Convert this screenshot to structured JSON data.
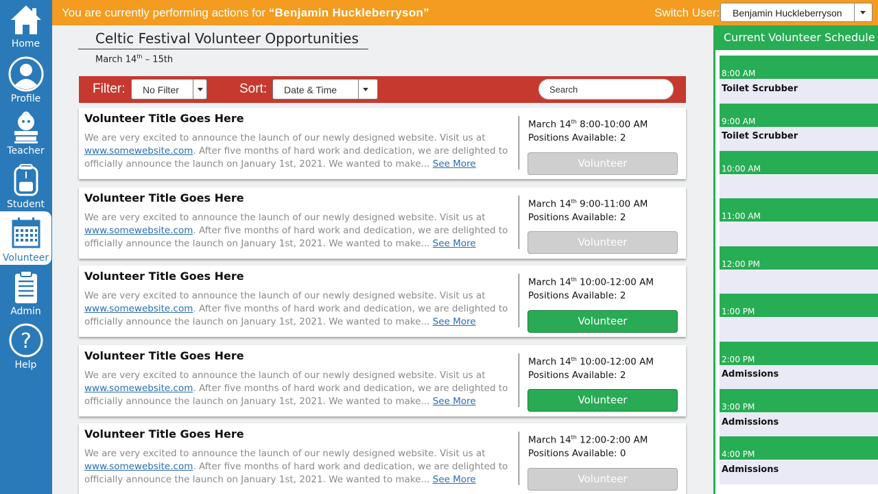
{
  "nav": [
    {
      "label": "Home",
      "icon": "home-icon"
    },
    {
      "label": "Profile",
      "icon": "profile-icon"
    },
    {
      "label": "Teacher",
      "icon": "teacher-icon"
    },
    {
      "label": "Student",
      "icon": "student-icon"
    },
    {
      "label": "Volunteer",
      "icon": "calendar-icon",
      "active": true
    },
    {
      "label": "Admin",
      "icon": "clipboard-icon"
    },
    {
      "label": "Help",
      "icon": "help-icon"
    }
  ],
  "banner": {
    "prefix": "You are currently  performing actions for ",
    "user": "“Benjamin  Huckleberryson”",
    "switch_label": "Switch User:",
    "selected_user": "Benjamin Huckleberryson"
  },
  "page": {
    "title": "Celtic Festival Volunteer Opportunities",
    "dates_prefix": "March 14",
    "dates_sup": "th",
    "dates_suffix": " – 15th"
  },
  "filterbar": {
    "filter_label": "Filter:",
    "filter_value": "No Filter",
    "sort_label": "Sort:",
    "sort_value": "Date & Time",
    "search_placeholder": "Search"
  },
  "cards": [
    {
      "title": "Volunteer Title Goes Here",
      "desc_1": "We are very excited to announce the launch of our newly designed website. Visit us at ",
      "link": "www.somewebsite.com",
      "desc_2": ".  After five months of hard work and dedication, we are delighted to officially announce the launch on January 1st, 2021. We wanted to make... ",
      "see_more": "See More",
      "date": "March 14",
      "date_sup": "th",
      "time": " 8:00-10:00 AM",
      "positions": "Positions Available: 2",
      "button": "Volunteer",
      "enabled": false
    },
    {
      "title": "Volunteer Title Goes Here",
      "desc_1": "We are very excited to announce the launch of our newly designed website. Visit us at ",
      "link": "www.somewebsite.com",
      "desc_2": ".  After five months of hard work and dedication, we are delighted to officially announce the launch on January 1st, 2021. We wanted to make... ",
      "see_more": "See More",
      "date": "March 14",
      "date_sup": "th",
      "time": " 9:00-11:00 AM",
      "positions": "Positions Available: 2",
      "button": "Volunteer",
      "enabled": false
    },
    {
      "title": "Volunteer Title Goes Here",
      "desc_1": "We are very excited to announce the launch of our newly designed website. Visit us at ",
      "link": "www.somewebsite.com",
      "desc_2": ".  After five months of hard work and dedication, we are delighted to officially announce the launch on January 1st, 2021. We wanted to make... ",
      "see_more": "See More",
      "date": "March 14",
      "date_sup": "th",
      "time": " 10:00-12:00 AM",
      "positions": "Positions Available: 2",
      "button": "Volunteer",
      "enabled": true
    },
    {
      "title": "Volunteer Title Goes Here",
      "desc_1": "We are very excited to announce the launch of our newly designed website. Visit us at ",
      "link": "www.somewebsite.com",
      "desc_2": ".  After five months of hard work and dedication, we are delighted to officially announce the launch on January 1st, 2021. We wanted to make... ",
      "see_more": "See More",
      "date": "March 14",
      "date_sup": "th",
      "time": " 10:00-12:00 AM",
      "positions": "Positions Available: 2",
      "button": "Volunteer",
      "enabled": true
    },
    {
      "title": "Volunteer Title Goes Here",
      "desc_1": "We are very excited to announce the launch of our newly designed website. Visit us at ",
      "link": "www.somewebsite.com",
      "desc_2": ".  After five months of hard work and dedication, we are delighted to officially announce the launch on January 1st, 2021. We wanted to make... ",
      "see_more": "See More",
      "date": "March 14",
      "date_sup": "th",
      "time": " 12:00-2:00 AM",
      "positions": "Positions Available: 0",
      "button": "Volunteer",
      "enabled": false
    }
  ],
  "schedule": {
    "title": "Current Volunteer Schedule",
    "slots": [
      {
        "time": "8:00 AM",
        "task": "Toilet Scrubber"
      },
      {
        "time": "9:00 AM",
        "task": "Toilet Scrubber"
      },
      {
        "time": "10:00 AM",
        "task": ""
      },
      {
        "time": "11:00 AM",
        "task": ""
      },
      {
        "time": "12:00 PM",
        "task": ""
      },
      {
        "time": "1:00 PM",
        "task": ""
      },
      {
        "time": "2:00 PM",
        "task": "Admissions"
      },
      {
        "time": "3:00 PM",
        "task": "Admissions"
      },
      {
        "time": "4:00 PM",
        "task": "Admissions"
      }
    ]
  },
  "colors": {
    "sidebar": "#2a7ab9",
    "banner": "#f39c1f",
    "filterbar": "#c6392e",
    "accent_green": "#27ad54"
  }
}
